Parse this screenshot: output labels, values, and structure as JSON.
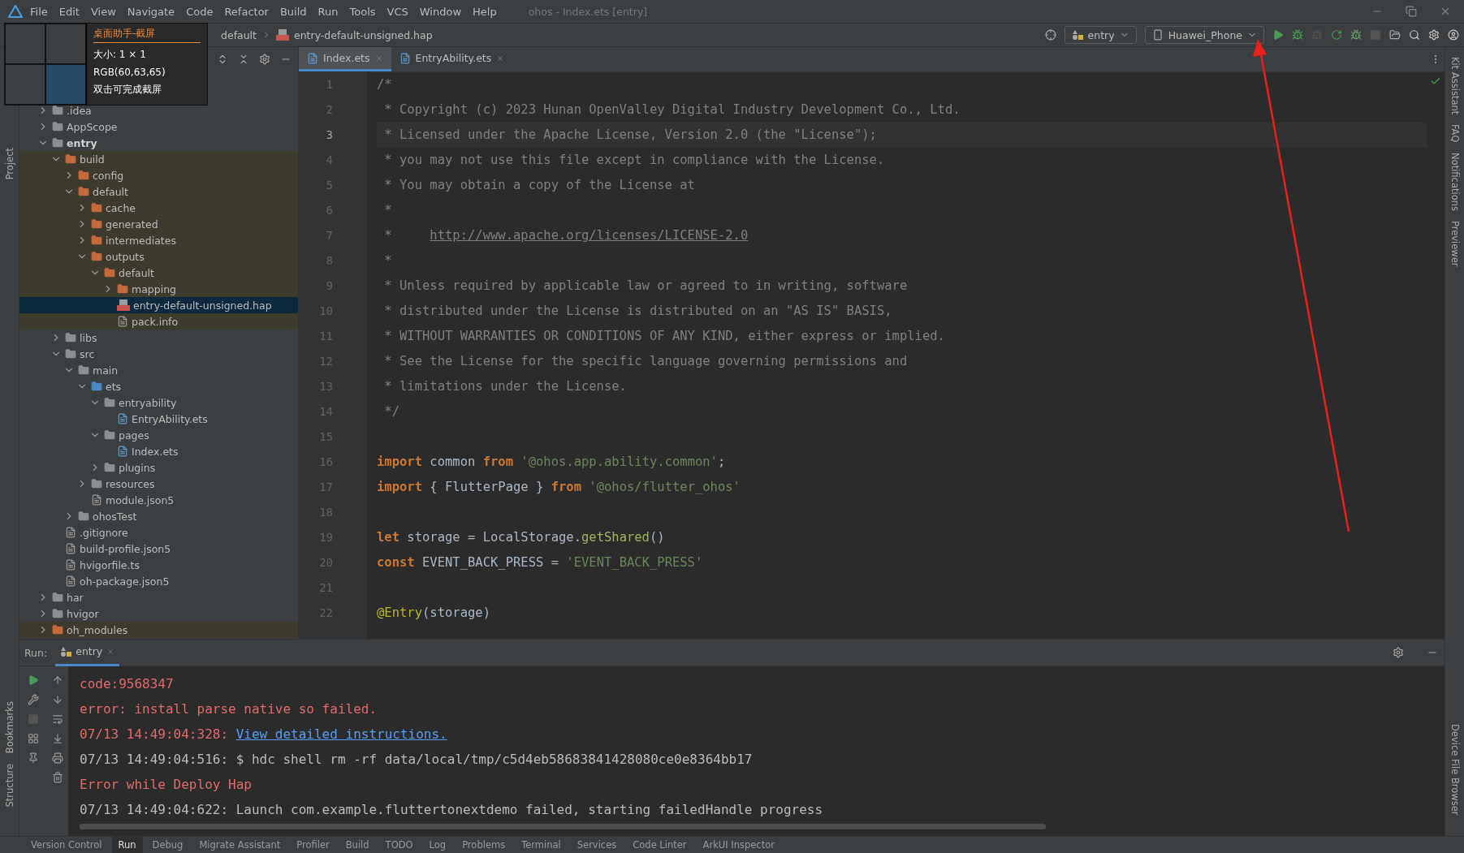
{
  "window": {
    "title": "ohos - Index.ets [entry]",
    "menu": [
      "File",
      "Edit",
      "View",
      "Navigate",
      "Code",
      "Refactor",
      "Build",
      "Run",
      "Tools",
      "VCS",
      "Window",
      "Help"
    ]
  },
  "breadcrumb": [
    "default",
    "entry-default-unsigned.hap"
  ],
  "toolbar": {
    "run_config": "entry",
    "device": "Huawei_Phone"
  },
  "screen_capture": {
    "title": "桌面助手-截屏",
    "size": "大小: 1 × 1",
    "pixel_value": "RGB(60,63,65)",
    "hint": "双击可完成截屏"
  },
  "left_tools": {
    "top": [
      "Project"
    ],
    "bottom": [
      "Bookmarks",
      "Structure"
    ]
  },
  "right_tools": {
    "top": [
      "Kit Assistant",
      "FAQ",
      "Notifications",
      "Previewer"
    ],
    "bottom": [
      "Device File Browser"
    ]
  },
  "editor_tabs": [
    {
      "label": "Index.ets",
      "selected": true
    },
    {
      "label": "EntryAbility.ets",
      "selected": false
    }
  ],
  "code_lines": [
    {
      "number": "1",
      "current": false,
      "segments": [
        {
          "kind": "comment",
          "text": "/*"
        }
      ]
    },
    {
      "number": "2",
      "current": false,
      "segments": [
        {
          "kind": "comment",
          "text": " * Copyright (c) 2023 Hunan OpenValley Digital Industry Development Co., Ltd."
        }
      ]
    },
    {
      "number": "3",
      "current": true,
      "segments": [
        {
          "kind": "comment",
          "text": " * Licensed under the Apache License, Version 2.0 (the \"License\");"
        }
      ]
    },
    {
      "number": "4",
      "current": false,
      "segments": [
        {
          "kind": "comment",
          "text": " * you may not use this file except in compliance with the License."
        }
      ]
    },
    {
      "number": "5",
      "current": false,
      "segments": [
        {
          "kind": "comment",
          "text": " * You may obtain a copy of the License at"
        }
      ]
    },
    {
      "number": "6",
      "current": false,
      "segments": [
        {
          "kind": "comment",
          "text": " *"
        }
      ]
    },
    {
      "number": "7",
      "current": false,
      "segments": [
        {
          "kind": "comment",
          "text": " *     "
        },
        {
          "kind": "url",
          "text": "http://www.apache.org/licenses/LICENSE-2.0"
        }
      ]
    },
    {
      "number": "8",
      "current": false,
      "segments": [
        {
          "kind": "comment",
          "text": " *"
        }
      ]
    },
    {
      "number": "9",
      "current": false,
      "segments": [
        {
          "kind": "comment",
          "text": " * Unless required by applicable law or agreed to in writing, software"
        }
      ]
    },
    {
      "number": "10",
      "current": false,
      "segments": [
        {
          "kind": "comment",
          "text": " * distributed under the License is distributed on an \"AS IS\" BASIS,"
        }
      ]
    },
    {
      "number": "11",
      "current": false,
      "segments": [
        {
          "kind": "comment",
          "text": " * WITHOUT WARRANTIES OR CONDITIONS OF ANY KIND, either express or implied."
        }
      ]
    },
    {
      "number": "12",
      "current": false,
      "segments": [
        {
          "kind": "comment",
          "text": " * See the License for the specific language governing permissions and"
        }
      ]
    },
    {
      "number": "13",
      "current": false,
      "segments": [
        {
          "kind": "comment",
          "text": " * limitations under the License."
        }
      ]
    },
    {
      "number": "14",
      "current": false,
      "segments": [
        {
          "kind": "comment",
          "text": " */"
        }
      ]
    },
    {
      "number": "15",
      "current": false
    },
    {
      "number": "16",
      "current": false,
      "segments": [
        {
          "kind": "keyword",
          "text": "import"
        },
        {
          "kind": "plain",
          "text": " common "
        },
        {
          "kind": "keyword",
          "text": "from "
        },
        {
          "kind": "string",
          "text": "'@ohos.app.ability.common'"
        },
        {
          "kind": "plain",
          "text": ";"
        }
      ]
    },
    {
      "number": "17",
      "current": false,
      "segments": [
        {
          "kind": "keyword",
          "text": "import"
        },
        {
          "kind": "plain",
          "text": " { FlutterPage } "
        },
        {
          "kind": "keyword",
          "text": "from "
        },
        {
          "kind": "string",
          "text": "'@ohos/flutter_ohos'"
        }
      ]
    },
    {
      "number": "18",
      "current": false
    },
    {
      "number": "19",
      "current": false,
      "segments": [
        {
          "kind": "keyword",
          "text": "let"
        },
        {
          "kind": "plain",
          "text": " storage = LocalStorage."
        },
        {
          "kind": "function",
          "text": "getShared"
        },
        {
          "kind": "plain",
          "text": "()"
        }
      ]
    },
    {
      "number": "20",
      "current": false,
      "segments": [
        {
          "kind": "keyword",
          "text": "const"
        },
        {
          "kind": "plain",
          "text": " EVENT_BACK_PRESS = "
        },
        {
          "kind": "string",
          "text": "'EVENT_BACK_PRESS'"
        }
      ]
    },
    {
      "number": "21",
      "current": false
    },
    {
      "number": "22",
      "current": false,
      "segments": [
        {
          "kind": "decorator",
          "text": "@Entry"
        },
        {
          "kind": "plain",
          "text": "(storage)"
        }
      ]
    }
  ],
  "project_tree": [
    {
      "label": ".idea",
      "kind": "folder",
      "expanded": false
    },
    {
      "label": "AppScope",
      "kind": "folder",
      "expanded": false
    },
    {
      "label": "entry",
      "kind": "module",
      "expanded": true,
      "children": [
        {
          "label": "build",
          "kind": "excluded",
          "expanded": true,
          "children": [
            {
              "label": "config",
              "kind": "excluded",
              "expanded": false
            },
            {
              "label": "default",
              "kind": "excluded",
              "expanded": true,
              "children": [
                {
                  "label": "cache",
                  "kind": "excluded",
                  "expanded": false
                },
                {
                  "label": "generated",
                  "kind": "excluded",
                  "expanded": false
                },
                {
                  "label": "intermediates",
                  "kind": "excluded",
                  "expanded": false
                },
                {
                  "label": "outputs",
                  "kind": "excluded",
                  "expanded": true,
                  "children": [
                    {
                      "label": "default",
                      "kind": "excluded",
                      "expanded": true,
                      "children": [
                        {
                          "label": "mapping",
                          "kind": "excluded",
                          "expanded": false
                        },
                        {
                          "label": "entry-default-unsigned.hap",
                          "kind": "hap",
                          "selected": true
                        },
                        {
                          "label": "pack.info",
                          "kind": "file",
                          "selected": false
                        }
                      ]
                    }
                  ]
                }
              ]
            }
          ]
        },
        {
          "label": "libs",
          "kind": "folder",
          "expanded": false
        },
        {
          "label": "src",
          "kind": "folder",
          "expanded": true,
          "children": [
            {
              "label": "main",
              "kind": "folder",
              "expanded": true,
              "children": [
                {
                  "label": "ets",
                  "kind": "source",
                  "expanded": true,
                  "children": [
                    {
                      "label": "entryability",
                      "kind": "folder",
                      "expanded": true,
                      "children": [
                        {
                          "label": "EntryAbility.ets",
                          "kind": "ets",
                          "selected": false
                        }
                      ]
                    },
                    {
                      "label": "pages",
                      "kind": "folder",
                      "expanded": true,
                      "children": [
                        {
                          "label": "Index.ets",
                          "kind": "ets",
                          "selected": false
                        }
                      ]
                    },
                    {
                      "label": "plugins",
                      "kind": "folder",
                      "expanded": false
                    }
                  ]
                },
                {
                  "label": "resources",
                  "kind": "folder",
                  "expanded": false
                },
                {
                  "label": "module.json5",
                  "kind": "file",
                  "selected": false
                }
              ]
            },
            {
              "label": "ohosTest",
              "kind": "folder",
              "expanded": false
            }
          ]
        },
        {
          "label": ".gitignore",
          "kind": "file",
          "selected": false
        },
        {
          "label": "build-profile.json5",
          "kind": "file",
          "selected": false
        },
        {
          "label": "hvigorfile.ts",
          "kind": "file",
          "selected": false
        },
        {
          "label": "oh-package.json5",
          "kind": "file",
          "selected": false
        }
      ]
    },
    {
      "label": "har",
      "kind": "folder",
      "expanded": false
    },
    {
      "label": "hvigor",
      "kind": "folder",
      "expanded": false
    },
    {
      "label": "oh_modules",
      "kind": "excluded",
      "expanded": false
    }
  ],
  "run_panel": {
    "label": "Run:",
    "tab": "entry",
    "lines": [
      {
        "segments": [
          {
            "kind": "error",
            "text": "code:9568347"
          }
        ]
      },
      {
        "segments": [
          {
            "kind": "error",
            "text": "error: install parse native so failed."
          }
        ]
      },
      {
        "segments": [
          {
            "kind": "error",
            "text": "07/13 14:49:04:328: "
          },
          {
            "kind": "link",
            "text": "View detailed instructions."
          }
        ]
      },
      {
        "segments": [
          {
            "kind": "plain",
            "text": "07/13 14:49:04:516: $ hdc shell rm -rf data/local/tmp/c5d4eb58683841428080ce0e8364bb17"
          }
        ]
      },
      {
        "segments": [
          {
            "kind": "error",
            "text": "Error while Deploy Hap"
          }
        ]
      },
      {
        "segments": [
          {
            "kind": "plain",
            "text": "07/13 14:49:04:622: Launch com.example.fluttertonextdemo failed, starting failedHandle progress"
          }
        ]
      }
    ]
  },
  "bottom_tabs": [
    {
      "label": "Version Control",
      "selected": false
    },
    {
      "label": "Run",
      "selected": true
    },
    {
      "label": "Debug",
      "selected": false
    },
    {
      "label": "Migrate Assistant",
      "selected": false
    },
    {
      "label": "Profiler",
      "selected": false
    },
    {
      "label": "Build",
      "selected": false
    },
    {
      "label": "TODO",
      "selected": false
    },
    {
      "label": "Log",
      "selected": false
    },
    {
      "label": "Problems",
      "selected": false
    },
    {
      "label": "Terminal",
      "selected": false
    },
    {
      "label": "Services",
      "selected": false
    },
    {
      "label": "Code Linter",
      "selected": false
    },
    {
      "label": "ArkUI Inspector",
      "selected": false
    }
  ]
}
